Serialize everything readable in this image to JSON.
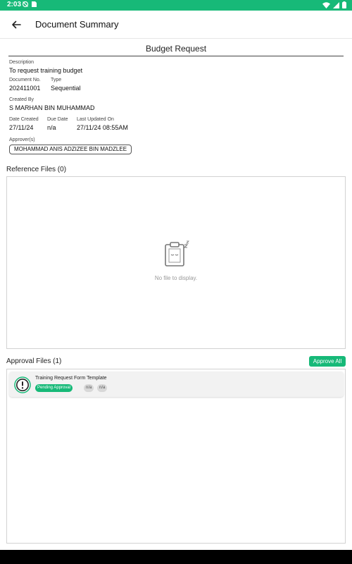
{
  "status_bar": {
    "time": "2:03",
    "icons": [
      "alarm-off-icon",
      "sim-card-icon",
      "wifi-icon",
      "cellular-icon",
      "battery-icon"
    ],
    "color": "#17b978"
  },
  "app_bar": {
    "title": "Document Summary",
    "back_icon": "arrow-left-icon"
  },
  "document": {
    "title": "Budget Request",
    "description_label": "Description",
    "description_value": "To request training budget",
    "number_label": "Document No.",
    "number_value": "202411001",
    "type_label": "Type",
    "type_value": "Sequential",
    "created_by_label": "Created By",
    "created_by_value": "S MARHAN BIN MUHAMMAD",
    "date_created_label": "Date Created",
    "date_created_value": "27/11/24",
    "due_date_label": "Due Date",
    "due_date_value": "n/a",
    "last_updated_label": "Last Updated On",
    "last_updated_value": "27/11/24 08:55AM",
    "approvers_label": "Approver(s)",
    "approvers": [
      "MOHAMMAD ANIS ADZIZEE BIN MADZLEE"
    ]
  },
  "reference_files": {
    "heading": "Reference Files (0)",
    "empty_text": "No file to display.",
    "empty_icon": "sleeping-clipboard-icon"
  },
  "approval_files": {
    "heading": "Approval Files (1)",
    "approve_all_label": "Approve All",
    "items": [
      {
        "name": "Training Request Form Template",
        "status": "Pending Approval",
        "tag1": "n/a",
        "tag2": "n/a",
        "icon": "exclamation-circle-icon"
      }
    ]
  },
  "colors": {
    "accent": "#17b978",
    "chip_grey": "#d8d8d8",
    "border": "#d2d2d2"
  }
}
